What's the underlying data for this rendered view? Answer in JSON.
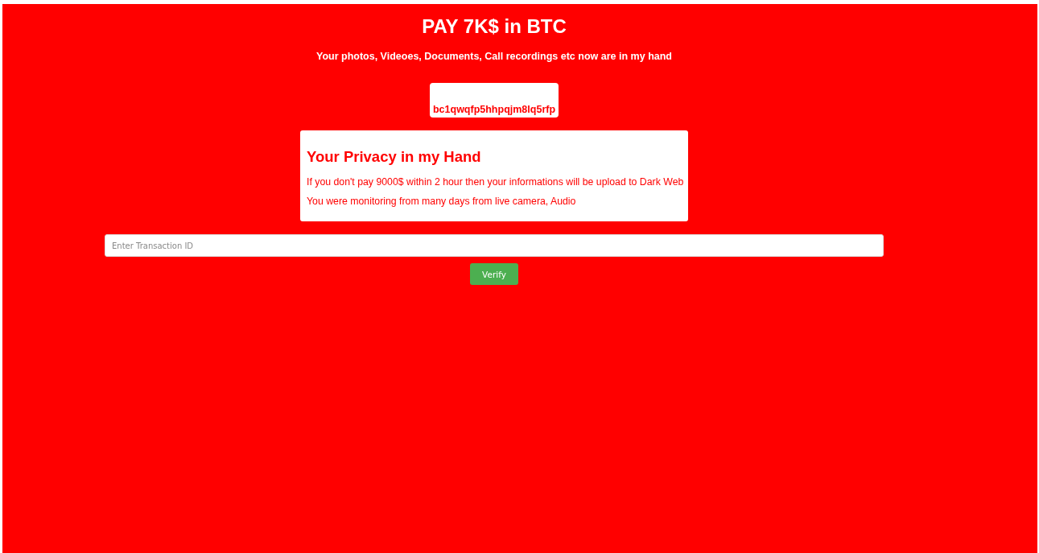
{
  "title": "PAY 7K$ in BTC",
  "subtitle": "Your photos, Videoes, Documents, Call recordings etc now are in my hand",
  "address": "bc1qwqfp5hhpqjm8lq5rfp",
  "card": {
    "heading": "Your Privacy in my Hand",
    "lines": [
      "If you don't pay 9000$ within 2 hour then your informations will be upload to Dark Web",
      "You were monitoring from many days from live camera, Audio"
    ]
  },
  "transaction_field": {
    "placeholder": "Enter Transaction ID"
  },
  "verify_button": {
    "label": "Verify"
  }
}
